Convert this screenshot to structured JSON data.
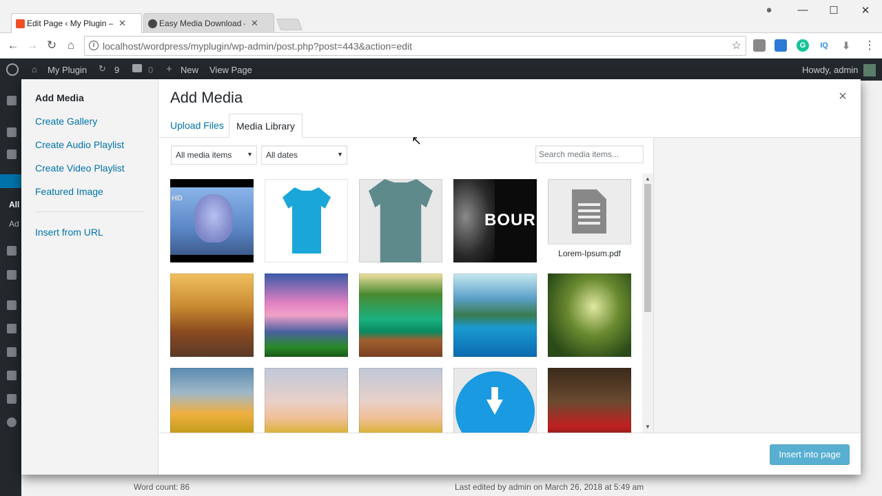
{
  "browser": {
    "tabs": [
      {
        "title": "Edit Page ‹ My Plugin —",
        "close": "✕",
        "favicon_color": "#f04e23"
      },
      {
        "title": "Easy Media Download —",
        "close": "✕",
        "favicon_color": "#464646"
      }
    ],
    "url": "localhost/wordpress/myplugin/wp-admin/post.php?post=443&action=edit",
    "controls": {
      "minimize": "—",
      "maximize": "☐",
      "close": "✕",
      "back": "←",
      "forward": "→",
      "reload": "↻",
      "home": "⌂",
      "star": "☆",
      "menu": "⋮",
      "profile": "●"
    }
  },
  "adminbar": {
    "site": "My Plugin",
    "updates": "9",
    "comments": "0",
    "new": "New",
    "view": "View Page",
    "howdy": "Howdy, admin"
  },
  "wp_bg": {
    "sidebar_letters": [
      "All",
      "Ad"
    ],
    "word_count": "Word count: 86",
    "last_edited": "Last edited by admin on March 26, 2018 at 5:49 am"
  },
  "modal": {
    "menu": [
      "Add Media",
      "Create Gallery",
      "Create Audio Playlist",
      "Create Video Playlist",
      "Featured Image"
    ],
    "insert_url": "Insert from URL",
    "title": "Add Media",
    "close": "×",
    "tabs": [
      "Upload Files",
      "Media Library"
    ],
    "filter_type": "All media items",
    "filter_date": "All dates",
    "search_placeholder": "Search media items...",
    "pdf_name": "Lorem-Ipsum.pdf",
    "insert_button": "Insert into page",
    "logo_text": "BOUR",
    "hd_badge": "HD"
  }
}
